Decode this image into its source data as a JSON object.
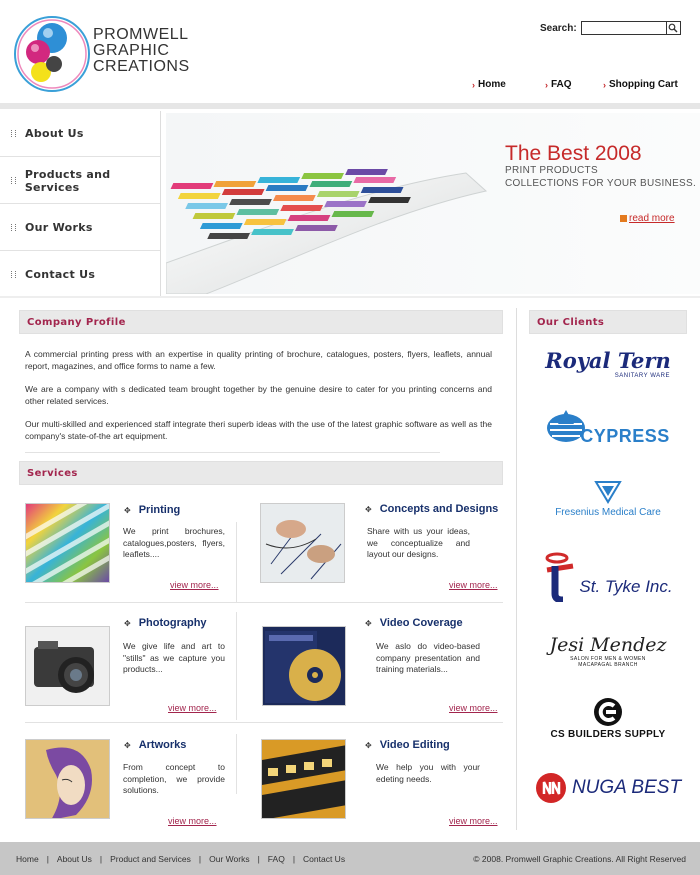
{
  "brand": {
    "line1": "PROMWELL",
    "line2": "GRAPHIC",
    "line3": "CREATIONS"
  },
  "search": {
    "label": "Search:",
    "value": "",
    "button_icon": "search-icon"
  },
  "topnav": [
    {
      "label": "Home"
    },
    {
      "label": "FAQ"
    },
    {
      "label": "Shopping Cart"
    }
  ],
  "sidebar": {
    "items": [
      {
        "label": "About Us"
      },
      {
        "label": "Products and Services"
      },
      {
        "label": "Our Works"
      },
      {
        "label": "Contact Us"
      }
    ]
  },
  "banner": {
    "title": "The Best 2008",
    "sub1": "PRINT PRODUCTS",
    "sub2": "COLLECTIONS FOR YOUR BUSINESS.",
    "read_more": "read more"
  },
  "profile": {
    "heading": "Company Profile",
    "p1": "A  commercial printing press with an expertise in quality printing of brochure, catalogues, posters, flyers, leaflets, annual report, magazines, and office forms to name a few.",
    "p2": "We are a company with s dedicated team brought together by the genuine desire to cater for you printing concerns and other related services.",
    "p3": "Our multi-skilled and experienced staff integrate theri superb ideas with the use of the latest graphic software as well as the company's state-of-the art equipment."
  },
  "services": {
    "heading": "Services",
    "items": [
      {
        "title": "Printing",
        "desc": "We print brochures, catalogues,posters, flyers, leaflets....",
        "link": "view more..."
      },
      {
        "title": "Concepts and Designs",
        "desc": "Share with us your ideas, we conceptualize and layout our designs.",
        "link": "view more..."
      },
      {
        "title": "Photography",
        "desc": "We give life and art to \"stills\" as we capture you products...",
        "link": "view more..."
      },
      {
        "title": "Video Coverage",
        "desc": "We aslo do video-based company presentation and training materials...",
        "link": "view more..."
      },
      {
        "title": "Artworks",
        "desc": "From concept to completion, we provide solutions.",
        "link": "view more..."
      },
      {
        "title": "Video Editing",
        "desc": "We help you with your edeting needs.",
        "link": "view more..."
      }
    ]
  },
  "clients": {
    "heading": "Our Clients",
    "items": [
      {
        "name": "Royal Tern",
        "sub": "SANITARY WARE"
      },
      {
        "name": "CYPRESS"
      },
      {
        "name": "Fresenius Medical Care"
      },
      {
        "name": "St. Tyke Inc."
      },
      {
        "name": "Jesi Mendez",
        "sub1": "SALON FOR MEN & WOMEN",
        "sub2": "MACAPAGAL BRANCH"
      },
      {
        "name": "CS BUILDERS SUPPLY"
      },
      {
        "name": "NUGA BEST"
      }
    ]
  },
  "footer": {
    "links": [
      "Home",
      "About Us",
      "Product and Services",
      "Our Works",
      "FAQ",
      "Contact Us"
    ],
    "separator": "|",
    "copyright": "© 2008. Promwell Graphic Creations. All Right Reserved"
  },
  "colors": {
    "accent": "#a2254d",
    "red": "#c62a2a",
    "navy": "#17306b",
    "footer": "#c6c6c6"
  }
}
